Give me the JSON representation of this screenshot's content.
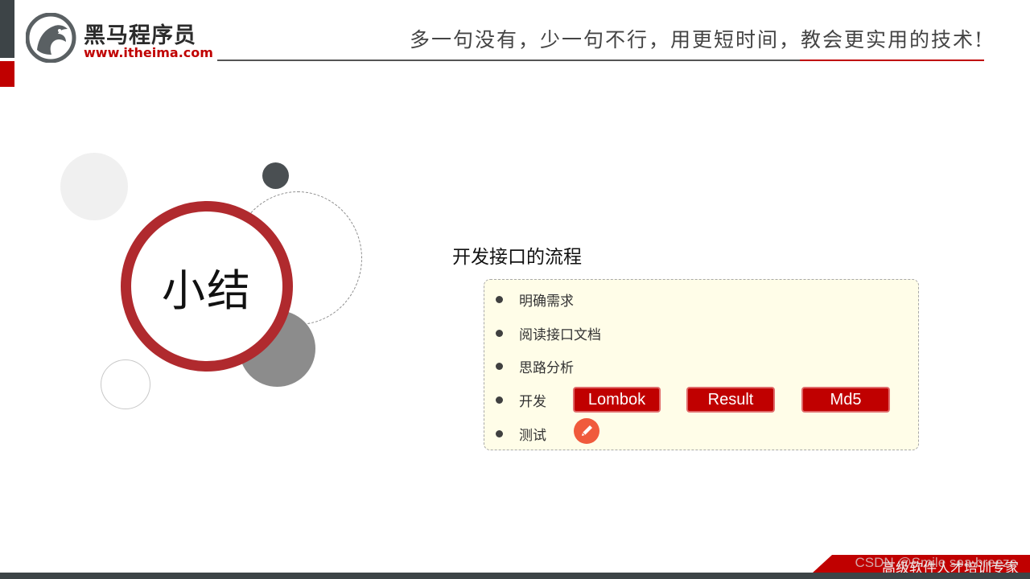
{
  "header": {
    "brand_cn": "黑马程序员",
    "brand_url": "www.itheima.com",
    "slogan": "多一句没有，少一句不行，用更短时间，教会更实用的技术!"
  },
  "slide": {
    "summary_label": "小结",
    "section_title": "开发接口的流程",
    "steps": [
      {
        "label": "明确需求"
      },
      {
        "label": "阅读接口文档"
      },
      {
        "label": "思路分析"
      },
      {
        "label": "开发"
      },
      {
        "label": "测试"
      }
    ],
    "dev_tags": [
      "Lombok",
      "Result",
      "Md5"
    ],
    "test_tool_icon": "pen-icon"
  },
  "footer": {
    "text": "高级软件人才培训专家",
    "watermark": "CSDN @Smile sea breeze"
  },
  "colors": {
    "accent_red": "#c00000",
    "ring_red": "#b02a2e",
    "dark_gray": "#3d4447",
    "panel_bg": "#fffde8"
  }
}
